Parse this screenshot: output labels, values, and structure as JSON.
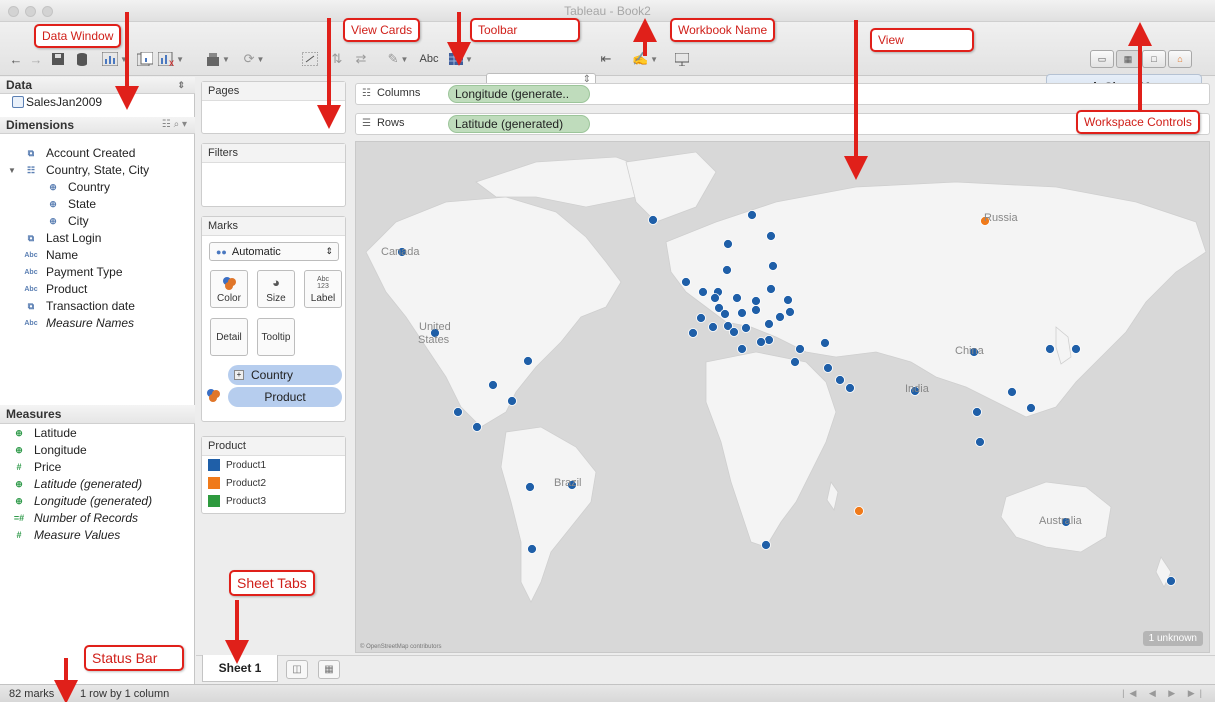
{
  "window": {
    "title": "Tableau - Book2"
  },
  "toolbar": {
    "abc": "Abc"
  },
  "show_me": {
    "label": "Show Me"
  },
  "data_window": {
    "header": "Data",
    "datasource": "SalesJan2009",
    "dimensions_header": "Dimensions",
    "dimensions": [
      {
        "icon": "date",
        "label": "Account Created"
      },
      {
        "icon": "hierarchy",
        "label": "Country, State, City"
      },
      {
        "icon": "geo",
        "label": "Country"
      },
      {
        "icon": "geo",
        "label": "State"
      },
      {
        "icon": "geo",
        "label": "City"
      },
      {
        "icon": "date",
        "label": "Last Login"
      },
      {
        "icon": "Abc",
        "label": "Name"
      },
      {
        "icon": "Abc",
        "label": "Payment Type"
      },
      {
        "icon": "Abc",
        "label": "Product"
      },
      {
        "icon": "date",
        "label": "Transaction date"
      },
      {
        "icon": "Abc",
        "label": "Measure Names"
      }
    ],
    "measures_header": "Measures",
    "measures": [
      {
        "icon": "geo",
        "label": "Latitude"
      },
      {
        "icon": "geo",
        "label": "Longitude"
      },
      {
        "icon": "#",
        "label": "Price"
      },
      {
        "icon": "geo",
        "label": "Latitude (generated)"
      },
      {
        "icon": "geo",
        "label": "Longitude (generated)"
      },
      {
        "icon": "=#",
        "label": "Number of Records"
      },
      {
        "icon": "#",
        "label": "Measure Values"
      }
    ]
  },
  "cards": {
    "pages": "Pages",
    "filters": "Filters",
    "marks": "Marks",
    "mark_type": "Automatic",
    "mark_buttons": [
      "Color",
      "Size",
      "Label",
      "Detail",
      "Tooltip"
    ],
    "label_icon": "Abc 123",
    "pills": [
      "Country",
      "Product"
    ],
    "legend_title": "Product",
    "legend": [
      {
        "label": "Product1",
        "color": "#1f5fa8"
      },
      {
        "label": "Product2",
        "color": "#f07a1a"
      },
      {
        "label": "Product3",
        "color": "#2e9a3e"
      }
    ]
  },
  "shelves": {
    "columns_label": "Columns",
    "columns_pill": "Longitude (generate..",
    "rows_label": "Rows",
    "rows_pill": "Latitude (generated)"
  },
  "view": {
    "country_labels": [
      "Russia",
      "Canada",
      "United",
      "States",
      "China",
      "India",
      "Brazil",
      "Australia"
    ],
    "attribution": "© OpenStreetMap contributors",
    "unknown": "1 unknown"
  },
  "sheet_tabs": {
    "active": "Sheet 1"
  },
  "status_bar": {
    "marks": "82 marks",
    "dims": "1 row by 1 column"
  },
  "annotations": {
    "data_window": "Data Window",
    "view_cards": "View Cards",
    "toolbar": "Toolbar",
    "workbook_name": "Workbook Name",
    "view": "View",
    "workspace_controls": "Workspace Controls",
    "sheet_tabs": "Sheet Tabs",
    "status_bar": "Status Bar"
  },
  "colors": {
    "mark_blue": "#1f5fa8",
    "mark_orange": "#f07a1a",
    "callout_red": "#e0201a"
  }
}
